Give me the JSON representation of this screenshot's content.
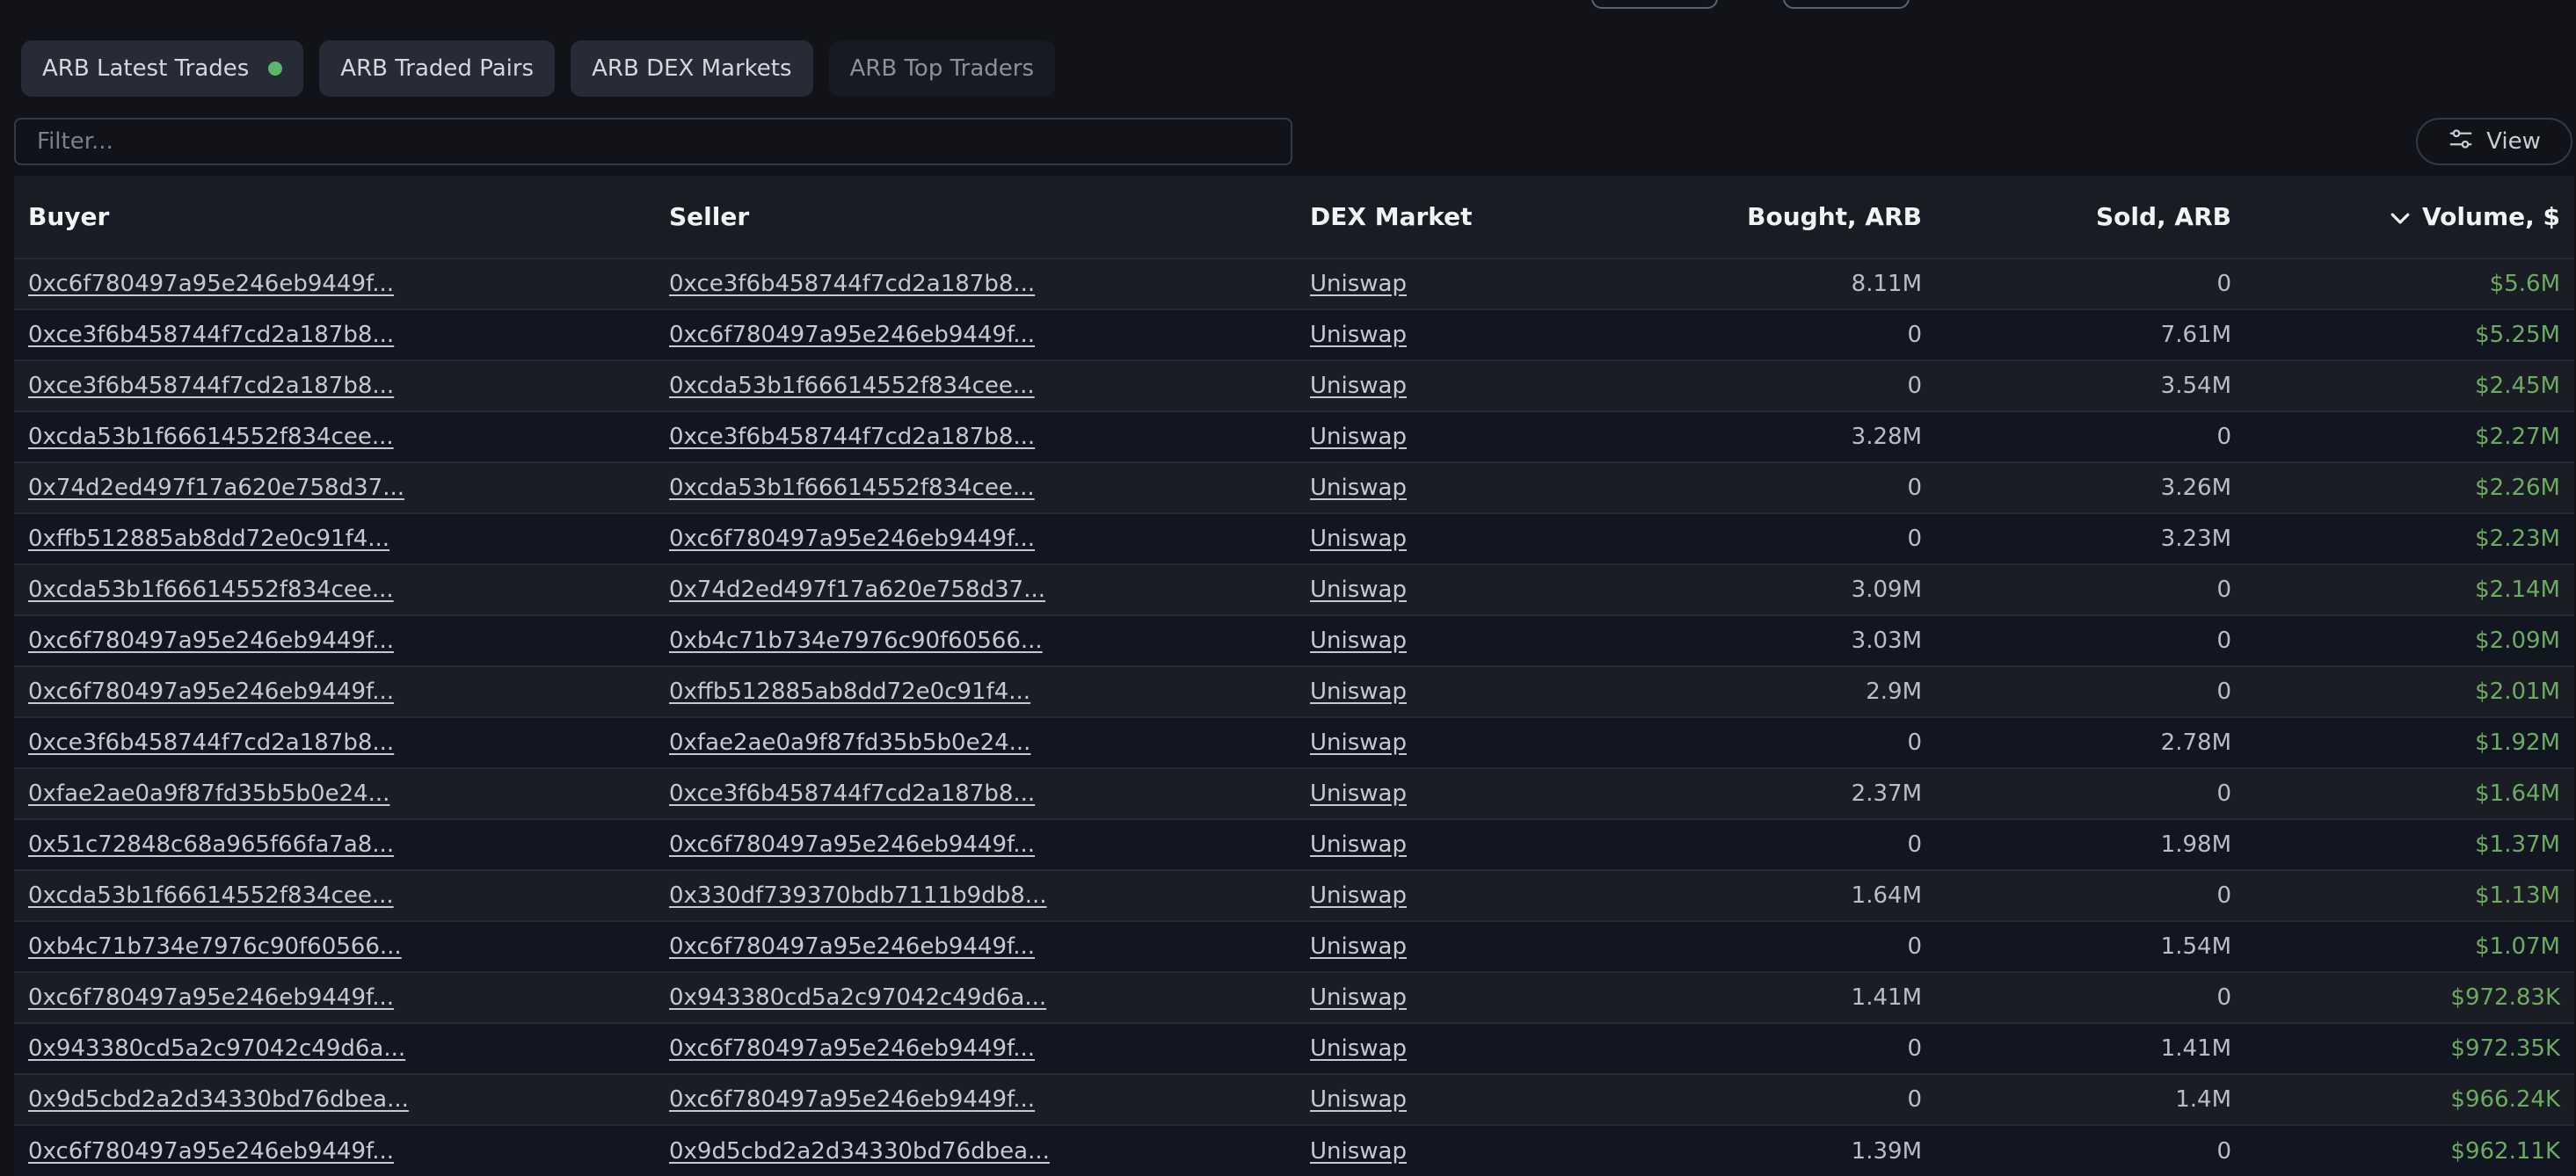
{
  "tabs": [
    {
      "label": "ARB Latest Trades",
      "live": true
    },
    {
      "label": "ARB Traded Pairs"
    },
    {
      "label": "ARB DEX Markets"
    },
    {
      "label": "ARB Top Traders"
    }
  ],
  "filter": {
    "placeholder": "Filter..."
  },
  "view_button": {
    "label": "View",
    "icon": "sliders-icon"
  },
  "table": {
    "columns": {
      "buyer": "Buyer",
      "seller": "Seller",
      "market": "DEX Market",
      "bought": "Bought, ARB",
      "sold": "Sold, ARB",
      "volume": "Volume, $"
    },
    "sort_icon": "chevron-down-icon",
    "rows": [
      {
        "buyer": "0xc6f780497a95e246eb9449f...",
        "seller": "0xce3f6b458744f7cd2a187b8...",
        "market": "Uniswap",
        "bought": "8.11M",
        "sold": "0",
        "volume": "$5.6M"
      },
      {
        "buyer": "0xce3f6b458744f7cd2a187b8...",
        "seller": "0xc6f780497a95e246eb9449f...",
        "market": "Uniswap",
        "bought": "0",
        "sold": "7.61M",
        "volume": "$5.25M"
      },
      {
        "buyer": "0xce3f6b458744f7cd2a187b8...",
        "seller": "0xcda53b1f66614552f834cee...",
        "market": "Uniswap",
        "bought": "0",
        "sold": "3.54M",
        "volume": "$2.45M"
      },
      {
        "buyer": "0xcda53b1f66614552f834cee...",
        "seller": "0xce3f6b458744f7cd2a187b8...",
        "market": "Uniswap",
        "bought": "3.28M",
        "sold": "0",
        "volume": "$2.27M"
      },
      {
        "buyer": "0x74d2ed497f17a620e758d37...",
        "seller": "0xcda53b1f66614552f834cee...",
        "market": "Uniswap",
        "bought": "0",
        "sold": "3.26M",
        "volume": "$2.26M"
      },
      {
        "buyer": "0xffb512885ab8dd72e0c91f4...",
        "seller": "0xc6f780497a95e246eb9449f...",
        "market": "Uniswap",
        "bought": "0",
        "sold": "3.23M",
        "volume": "$2.23M"
      },
      {
        "buyer": "0xcda53b1f66614552f834cee...",
        "seller": "0x74d2ed497f17a620e758d37...",
        "market": "Uniswap",
        "bought": "3.09M",
        "sold": "0",
        "volume": "$2.14M"
      },
      {
        "buyer": "0xc6f780497a95e246eb9449f...",
        "seller": "0xb4c71b734e7976c90f60566...",
        "market": "Uniswap",
        "bought": "3.03M",
        "sold": "0",
        "volume": "$2.09M"
      },
      {
        "buyer": "0xc6f780497a95e246eb9449f...",
        "seller": "0xffb512885ab8dd72e0c91f4...",
        "market": "Uniswap",
        "bought": "2.9M",
        "sold": "0",
        "volume": "$2.01M"
      },
      {
        "buyer": "0xce3f6b458744f7cd2a187b8...",
        "seller": "0xfae2ae0a9f87fd35b5b0e24...",
        "market": "Uniswap",
        "bought": "0",
        "sold": "2.78M",
        "volume": "$1.92M"
      },
      {
        "buyer": "0xfae2ae0a9f87fd35b5b0e24...",
        "seller": "0xce3f6b458744f7cd2a187b8...",
        "market": "Uniswap",
        "bought": "2.37M",
        "sold": "0",
        "volume": "$1.64M"
      },
      {
        "buyer": "0x51c72848c68a965f66fa7a8...",
        "seller": "0xc6f780497a95e246eb9449f...",
        "market": "Uniswap",
        "bought": "0",
        "sold": "1.98M",
        "volume": "$1.37M"
      },
      {
        "buyer": "0xcda53b1f66614552f834cee...",
        "seller": "0x330df739370bdb7111b9db8...",
        "market": "Uniswap",
        "bought": "1.64M",
        "sold": "0",
        "volume": "$1.13M"
      },
      {
        "buyer": "0xb4c71b734e7976c90f60566...",
        "seller": "0xc6f780497a95e246eb9449f...",
        "market": "Uniswap",
        "bought": "0",
        "sold": "1.54M",
        "volume": "$1.07M"
      },
      {
        "buyer": "0xc6f780497a95e246eb9449f...",
        "seller": "0x943380cd5a2c97042c49d6a...",
        "market": "Uniswap",
        "bought": "1.41M",
        "sold": "0",
        "volume": "$972.83K"
      },
      {
        "buyer": "0x943380cd5a2c97042c49d6a...",
        "seller": "0xc6f780497a95e246eb9449f...",
        "market": "Uniswap",
        "bought": "0",
        "sold": "1.41M",
        "volume": "$972.35K"
      },
      {
        "buyer": "0x9d5cbd2a2d34330bd76dbea...",
        "seller": "0xc6f780497a95e246eb9449f...",
        "market": "Uniswap",
        "bought": "0",
        "sold": "1.4M",
        "volume": "$966.24K"
      },
      {
        "buyer": "0xc6f780497a95e246eb9449f...",
        "seller": "0x9d5cbd2a2d34330bd76dbea...",
        "market": "Uniswap",
        "bought": "1.39M",
        "sold": "0",
        "volume": "$962.11K"
      }
    ]
  }
}
